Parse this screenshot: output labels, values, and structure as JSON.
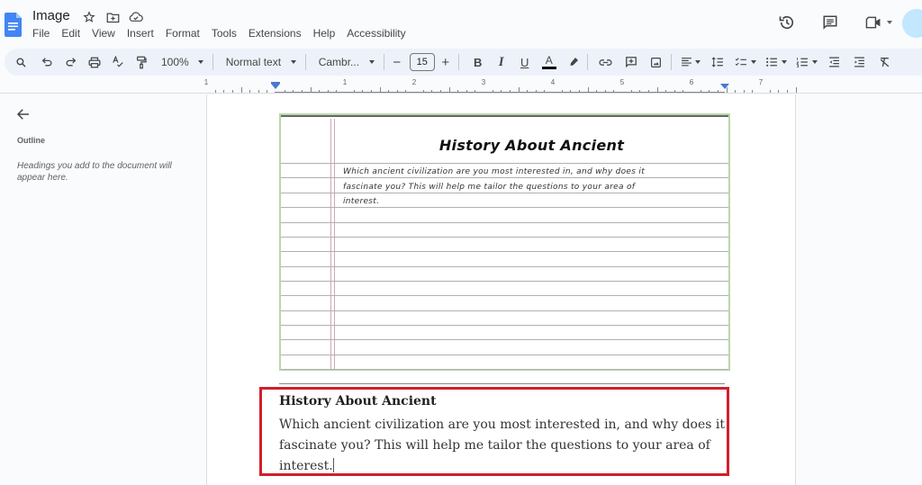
{
  "app": {
    "doc_title": "Image",
    "menu": [
      "File",
      "Edit",
      "View",
      "Insert",
      "Format",
      "Tools",
      "Extensions",
      "Help",
      "Accessibility"
    ],
    "title_icons": [
      "star-icon",
      "move-to-folder-icon",
      "cloud-saved-icon"
    ],
    "right_actions": [
      "version-history-icon",
      "comments-icon",
      "meet-icon"
    ]
  },
  "toolbar": {
    "zoom": "100%",
    "style": "Normal text",
    "font": "Cambr...",
    "font_size": "15",
    "decrease_label": "−",
    "increase_label": "+",
    "bold": "B",
    "italic": "I",
    "underline": "U",
    "text_color_label": "A",
    "text_color": "#000000"
  },
  "ruler": {
    "numbers": [
      "1",
      "1",
      "2",
      "3",
      "4",
      "5",
      "6",
      "7"
    ]
  },
  "sidebar": {
    "outline_label": "Outline",
    "hint": "Headings you add to the document will appear here."
  },
  "image_content": {
    "title": "History About Ancient",
    "body_lines": [
      "Which ancient civilization are you most interested in, and why does it",
      "fascinate you? This will help me tailor the questions to your area of",
      "interest."
    ]
  },
  "document": {
    "heading": "History About Ancient",
    "body": "Which ancient civilization are you most interested in, and why does it fascinate you? This will help me tailor the questions to your area of interest.",
    "highlight_color": "#d01f2a"
  }
}
